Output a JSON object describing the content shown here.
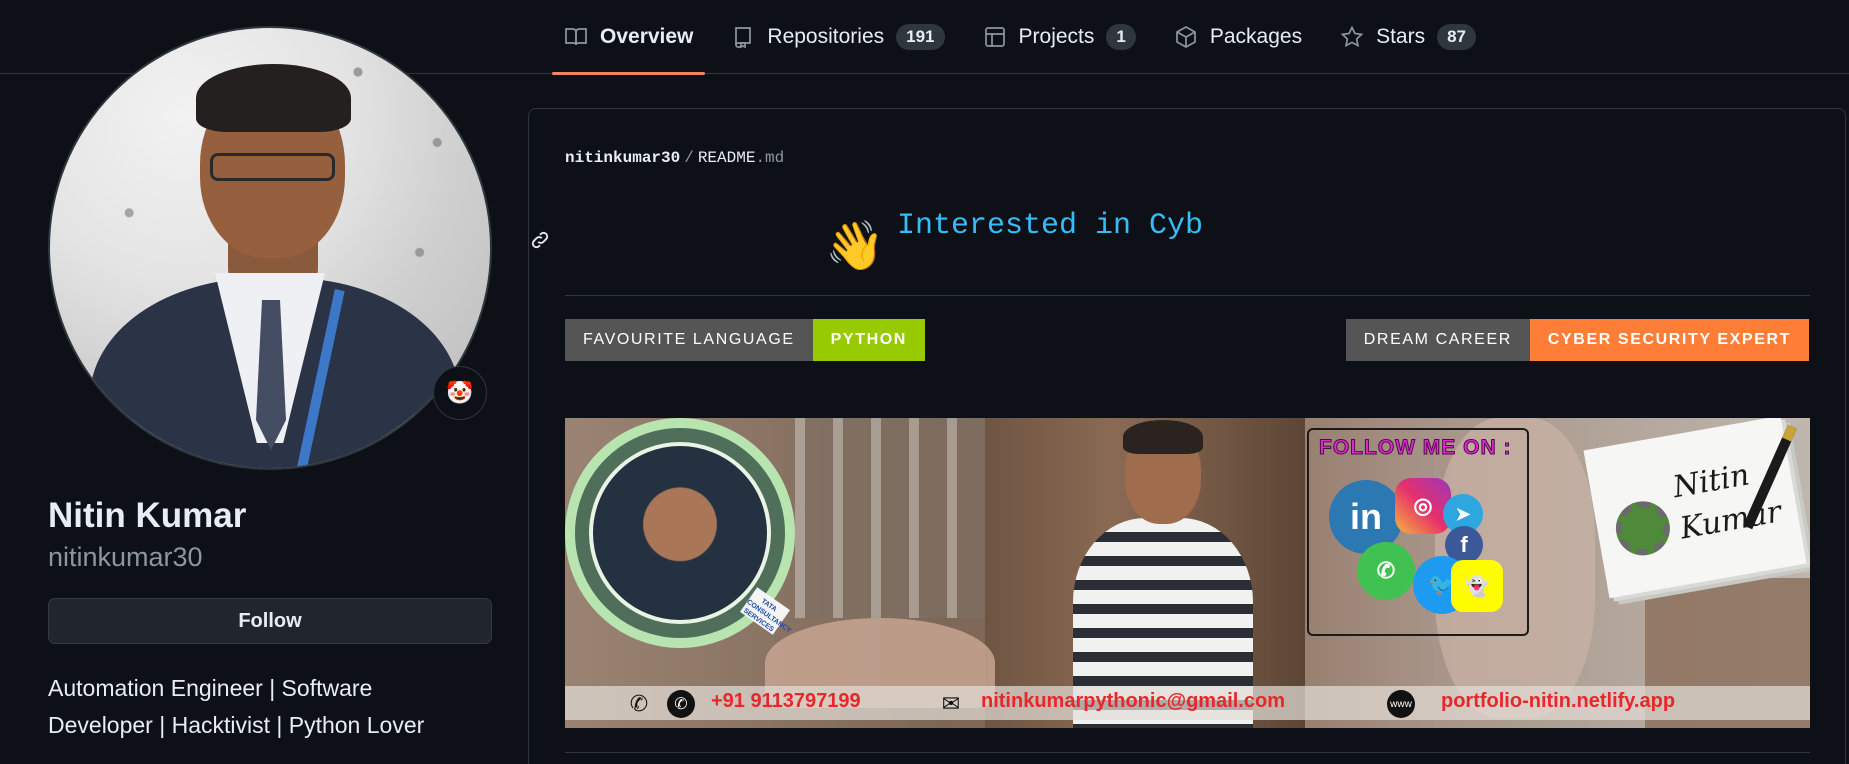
{
  "nav": {
    "tabs": [
      {
        "label": "Overview",
        "counter": "",
        "icon": "book-icon",
        "active": true
      },
      {
        "label": "Repositories",
        "counter": "191",
        "icon": "repo-icon"
      },
      {
        "label": "Projects",
        "counter": "1",
        "icon": "table-icon"
      },
      {
        "label": "Packages",
        "counter": "",
        "icon": "package-icon"
      },
      {
        "label": "Stars",
        "counter": "87",
        "icon": "star-icon"
      }
    ]
  },
  "profile": {
    "name": "Nitin Kumar",
    "username": "nitinkumar30",
    "follow_label": "Follow",
    "bio": "Automation Engineer | Software Developer | Hacktivist | Python Lover",
    "status_emoji": "🤡"
  },
  "readme": {
    "owner": "nitinkumar30",
    "separator": "/",
    "file": "README",
    "ext": ".md",
    "wave": "👋",
    "typing_text": "Interested in Cyb",
    "badges": {
      "language": {
        "label": "FAVOURITE LANGUAGE",
        "value": "PYTHON",
        "color": "#97ca00"
      },
      "career": {
        "label": "DREAM CAREER",
        "value": "CYBER SECURITY EXPERT",
        "color": "#fe7d37"
      }
    }
  },
  "banner": {
    "follow_title": "FOLLOW ME ON :",
    "card_name": "Nitin Kumar",
    "tag_text": "TATA CONSULTANCY SERVICES",
    "phone": "+91 9113797199",
    "email": "nitinkumarpythonic@gmail.com",
    "website": "portfolio-nitin.netlify.app",
    "social_icons": {
      "linkedin": "in",
      "instagram": "◎",
      "telegram": "➤",
      "whatsapp": "✆",
      "twitter": "🐦",
      "facebook": "f",
      "snapchat": "👻"
    }
  },
  "colors": {
    "accent": "#f78166",
    "link": "#36bcf7",
    "contact_text": "#e8272b"
  }
}
